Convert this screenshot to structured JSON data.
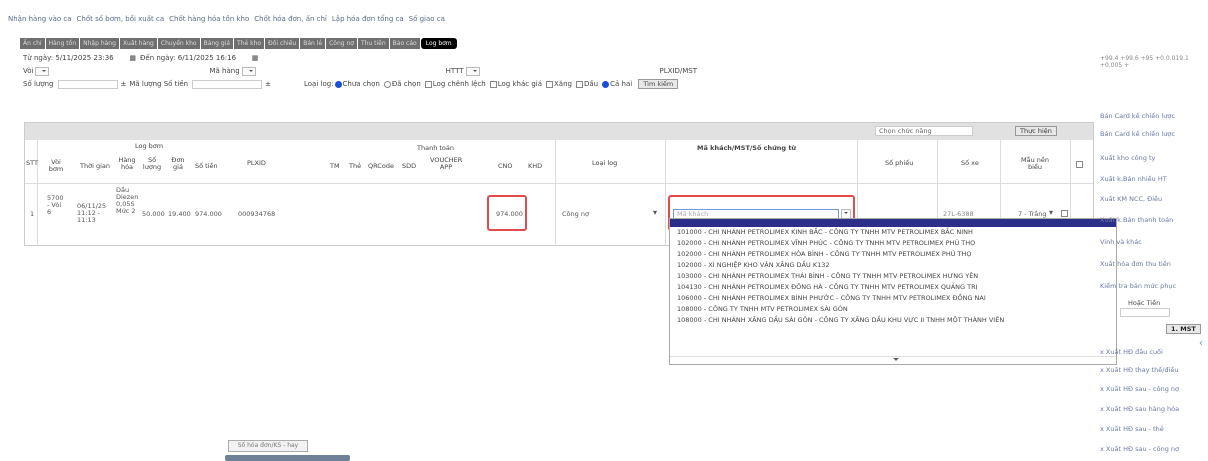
{
  "topnav": [
    "Nhận hàng vào ca",
    "Chốt số bơm, bồi xuất ca",
    "Chốt hàng hóa tồn kho",
    "Chốt hóa đơn, ấn chỉ",
    "Lập hóa đơn tổng ca",
    "Số giao ca"
  ],
  "tabs": [
    "Ấn chỉ",
    "Hàng tồn",
    "Nhập hàng",
    "Xuất hàng",
    "Chuyển kho",
    "Bảng giá",
    "Thẻ kho",
    "Đối chiếu",
    "Bán lẻ",
    "Công nợ",
    "Thu tiền",
    "Bảo cáo",
    "Log bơm"
  ],
  "active_tab": "Log bơm",
  "filters": {
    "tu_ngay_label": "Từ ngày:",
    "tu_ngay_value": "5/11/2025 23:36",
    "den_ngay_label": "Đến ngày:",
    "den_ngay_value": "6/11/2025 16:16",
    "voi_label": "Vòi",
    "ma_hang_label": "Mã hàng",
    "httt_label": "HTTT",
    "pl_label": "PLXID/MST",
    "so_luong_label": "Số lượng",
    "ma_luong_label": "Mã lượng",
    "so_tien_label": "Số tiền",
    "loai_log_label": "Loại log:",
    "radio_chua_chon": "Chưa chọn",
    "radio_da_chon": "Đã chọn",
    "chk_log_chinh_lich": "Log chênh lệch",
    "chk_log_khac_gia": "Log khác giá",
    "chk_xang": "Xăng",
    "chk_dau": "Dầu",
    "radio_ca_hai": "Cả hai",
    "search_button": "Tìm kiếm"
  },
  "grid": {
    "chon_cot": "Chọn chức năng",
    "thuc_hien": "Thực hiện",
    "headers": {
      "stt": "STT",
      "log_bom": "Log bơm",
      "voi_bom": "Vòi bơm",
      "thoi_gian": "Thời gian",
      "hang_hoa": "Hàng hóa",
      "so_luong": "Số lượng",
      "don_gia": "Đơn giá",
      "so_tien": "Số tiền",
      "plxid": "PLXID",
      "thanh_toan": "Thanh toán",
      "tm": "TM",
      "the": "Thẻ",
      "qrcode": "QRCode",
      "sdd": "SDD",
      "voucher": "VOUCHER APP",
      "cno": "CNO",
      "khd": "KHD",
      "loai_log": "Loại log",
      "ma_kh": "Mã khách/MST/Số chứng từ",
      "so_phieu": "Số phiếu",
      "so_xe": "Số xe",
      "mau_bieu": "Mẫu nền biểu"
    },
    "row": {
      "stt": "1",
      "voi": "5700 - Vòi 6",
      "thoi_gian": "06/11/25 11:12 - 11:13",
      "hang_hoa": "Dầu Diezen 0,05S Mức 2",
      "so_luong": "50.000",
      "don_gia": "19.400",
      "so_tien": "974.000",
      "plxid": "000934768",
      "cno": "974.000",
      "loai_log": "Công nợ",
      "ma_kh_placeholder": "Mã khách",
      "so_xe": "27L-6388",
      "mau_bieu": "7 - Trắng"
    }
  },
  "dropdown": [
    "101000 - CHI NHÁNH PETROLIMEX KINH BẮC - CÔNG TY TNHH MTV PETROLIMEX BẮC NINH",
    "102000 - CHI NHÁNH PETROLIMEX VĨNH PHÚC - CÔNG TY TNHH MTV PETROLIMEX PHÚ THỌ",
    "102000 - CHI NHÁNH PETROLIMEX HÒA BÌNH - CÔNG TY TNHH MTV PETROLIMEX PHÚ THỌ",
    "102000 - XÍ NGHIỆP KHO VẬN XĂNG DẦU K132",
    "103000 - CHI NHÁNH PETROLIMEX THÁI BÌNH - CÔNG TY TNHH MTV PETROLIMEX HƯNG YÊN",
    "104130 - CHI NHÁNH PETROLIMEX ĐÔNG HÀ - CÔNG TY TNHH MTV PETROLIMEX QUẢNG TRỊ",
    "106000 - CHI NHÁNH PETROLIMEX BÌNH PHƯỚC - CÔNG TY TNHH MTV PETROLIMEX ĐỒNG NAI",
    "108000 - CÔNG TY TNHH MTV PETROLIMEX SÀI GÒN",
    "108000 - CHI NHÁNH XĂNG DẦU SÀI GÒN - CÔNG TY XĂNG DẦU KHU VỰC II TNHH MỘT THÀNH VIÊN"
  ],
  "right_panel": {
    "top_values": "+99.4  +99.6  +95  +0.0.019.1  +0.005  +",
    "items": [
      "Bán Card kế chiến lược",
      "Bán Card kế chiến lược",
      "Xuất kho công ty",
      "Xuất k.Bán nhiều HT",
      "Xuất KM NCC, Điều",
      "Xuất k.Bán thanh toán",
      "Vinh và khác",
      "Xuất hóa đơn thu tiền",
      "Kiểm tra bán mức phục"
    ],
    "hoac_tien": "Hoặc Tiền",
    "mst_button": "1. MST",
    "bottom_items": [
      "x Xuất HĐ đầu cuối",
      "x Xuất HĐ thay thế/điều",
      "x Xuất HĐ sau - công nợ",
      "x Xuất HĐ sau hàng hóa",
      "x Xuất HĐ sau - thẻ",
      "x Xuất HĐ sau - công nợ"
    ]
  },
  "bottom_tab": "Số hóa đơn/KS - hay"
}
